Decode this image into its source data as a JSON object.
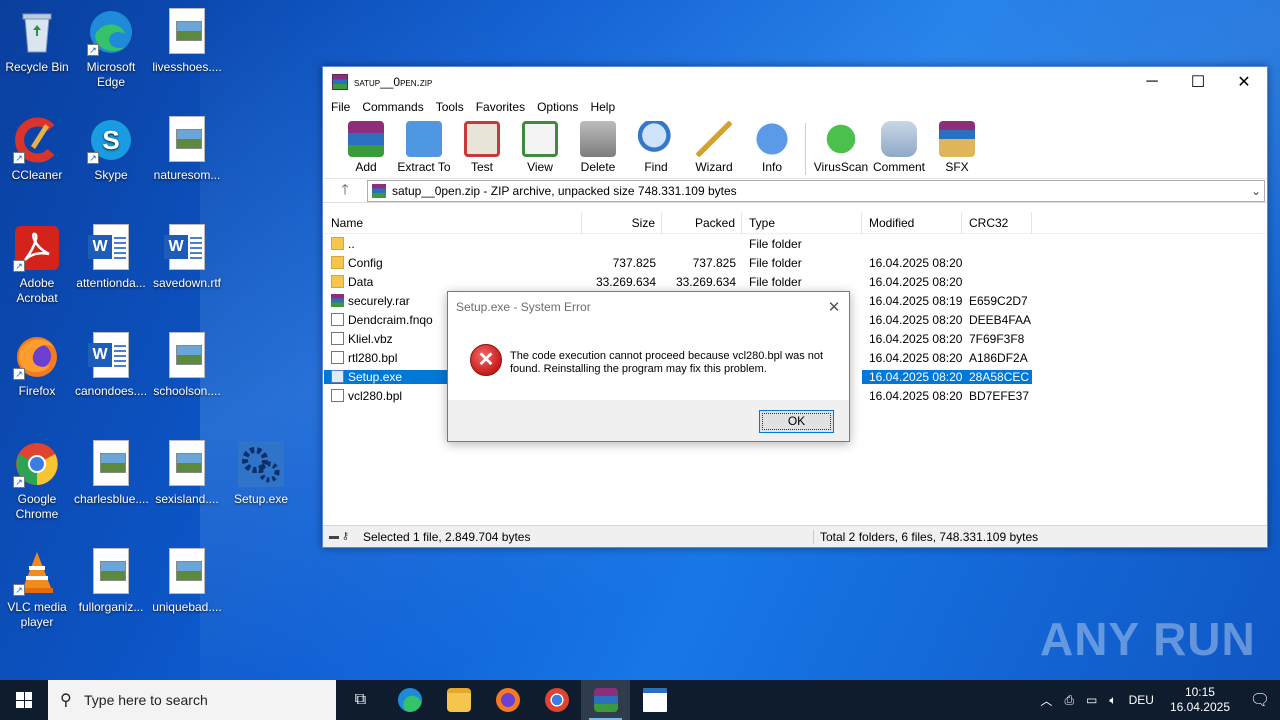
{
  "desktop": {
    "icons": [
      {
        "label": "Recycle Bin",
        "icon": "recycle-bin-icon"
      },
      {
        "label": "Microsoft Edge",
        "icon": "edge-icon"
      },
      {
        "label": "livesshoes....",
        "icon": "image-file-icon"
      },
      {
        "label": "CCleaner",
        "icon": "ccleaner-icon"
      },
      {
        "label": "Skype",
        "icon": "skype-icon"
      },
      {
        "label": "naturesom...",
        "icon": "image-file-icon"
      },
      {
        "label": "Adobe Acrobat",
        "icon": "acrobat-icon"
      },
      {
        "label": "attentionda...",
        "icon": "word-doc-icon"
      },
      {
        "label": "savedown.rtf",
        "icon": "word-doc-icon"
      },
      {
        "label": "Firefox",
        "icon": "firefox-icon"
      },
      {
        "label": "canondoes....",
        "icon": "word-doc-icon"
      },
      {
        "label": "schoolson....",
        "icon": "image-file-icon"
      },
      {
        "label": "Google Chrome",
        "icon": "chrome-icon"
      },
      {
        "label": "charlesblue....",
        "icon": "image-file-icon"
      },
      {
        "label": "sexisland....",
        "icon": "image-file-icon"
      },
      {
        "label": "Setup.exe",
        "icon": "setup-gear-icon"
      },
      {
        "label": "VLC media player",
        "icon": "vlc-icon"
      },
      {
        "label": "fullorganiz...",
        "icon": "image-file-icon"
      },
      {
        "label": "uniquebad....",
        "icon": "image-file-icon"
      }
    ]
  },
  "window": {
    "title": "satup__0pen.zip",
    "controls": {
      "minimize": "─",
      "maximize": "☐",
      "close": "✕"
    },
    "menu": [
      "File",
      "Commands",
      "Tools",
      "Favorites",
      "Options",
      "Help"
    ],
    "toolbar": [
      {
        "label": "Add",
        "color": "#7a3d8e"
      },
      {
        "label": "Extract To",
        "color": "#3b86d6"
      },
      {
        "label": "Test",
        "color": "#c83a3a"
      },
      {
        "label": "View",
        "color": "#3f8a3f"
      },
      {
        "label": "Delete",
        "color": "#8a8a8a"
      },
      {
        "label": "Find",
        "color": "#3577c9"
      },
      {
        "label": "Wizard",
        "color": "#d6a12b"
      },
      {
        "label": "Info",
        "color": "#2b6fc0"
      },
      {
        "label": "VirusScan",
        "color": "#3aa33a"
      },
      {
        "label": "Comment",
        "color": "#6f8fb0"
      },
      {
        "label": "SFX",
        "color": "#c98a3a"
      }
    ],
    "address": "satup__0pen.zip - ZIP archive, unpacked size 748.331.109 bytes",
    "columns": {
      "name": "Name",
      "size": "Size",
      "packed": "Packed",
      "type": "Type",
      "modified": "Modified",
      "crc": "CRC32"
    },
    "files": [
      {
        "name": "..",
        "size": "",
        "packed": "",
        "type": "File folder",
        "modified": "",
        "crc": "",
        "kind": "folder"
      },
      {
        "name": "Config",
        "size": "737.825",
        "packed": "737.825",
        "type": "File folder",
        "modified": "16.04.2025 08:20",
        "crc": "",
        "kind": "folder"
      },
      {
        "name": "Data",
        "size": "33.269.634",
        "packed": "33.269.634",
        "type": "File folder",
        "modified": "16.04.2025 08:20",
        "crc": "",
        "kind": "folder"
      },
      {
        "name": "securely.rar",
        "size": "",
        "packed": "",
        "type": "",
        "modified": "16.04.2025 08:19",
        "crc": "E659C2D7",
        "kind": "rar"
      },
      {
        "name": "Dendcraim.fnqo",
        "size": "",
        "packed": "",
        "type": "",
        "modified": "16.04.2025 08:20",
        "crc": "DEEB4FAA",
        "kind": "file"
      },
      {
        "name": "Kliel.vbz",
        "size": "",
        "packed": "",
        "type": "",
        "modified": "16.04.2025 08:20",
        "crc": "7F69F3F8",
        "kind": "file"
      },
      {
        "name": "rtl280.bpl",
        "size": "",
        "packed": "",
        "type": "",
        "modified": "16.04.2025 08:20",
        "crc": "A186DF2A",
        "kind": "file"
      },
      {
        "name": "Setup.exe",
        "size": "",
        "packed": "",
        "type": "",
        "modified": "16.04.2025 08:20",
        "crc": "28A58CEC",
        "kind": "exe",
        "selected": true
      },
      {
        "name": "vcl280.bpl",
        "size": "",
        "packed": "",
        "type": "",
        "modified": "16.04.2025 08:20",
        "crc": "BD7EFE37",
        "kind": "file"
      }
    ],
    "status_left": "Selected 1 file, 2.849.704 bytes",
    "status_right": "Total 2 folders, 6 files, 748.331.109 bytes"
  },
  "dialog": {
    "title": "Setup.exe - System Error",
    "message": "The code execution cannot proceed because vcl280.bpl was not found. Reinstalling the program may fix this problem.",
    "ok": "OK",
    "close": "✕"
  },
  "taskbar": {
    "search_placeholder": "Type here to search",
    "language": "DEU",
    "time": "10:15",
    "date": "16.04.2025"
  },
  "watermark": "ANY RUN"
}
